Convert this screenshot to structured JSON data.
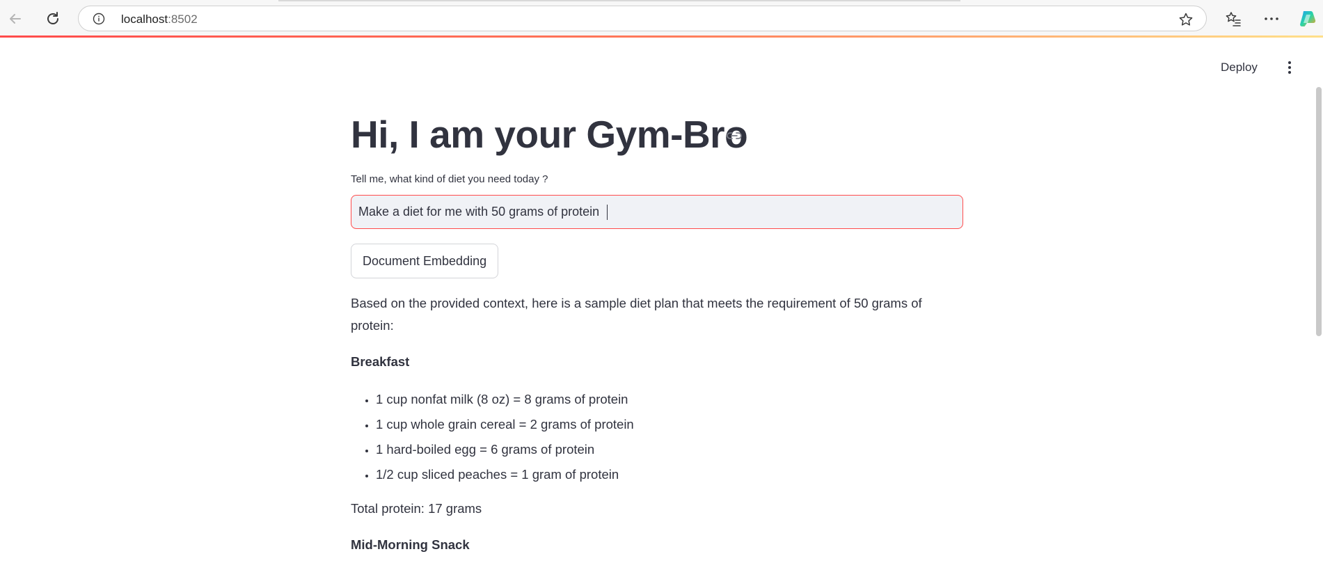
{
  "browser": {
    "url_host": "localhost",
    "url_port": ":8502"
  },
  "app_header": {
    "deploy_label": "Deploy"
  },
  "main": {
    "title": "Hi, I am your Gym-Bro",
    "input_label": "Tell me, what kind of diet you need today ?",
    "input_value": "Make a diet for me with 50 grams of protein",
    "embed_button_label": "Document Embedding",
    "answer": {
      "intro": "Based on the provided context, here is a sample diet plan that meets the requirement of 50 grams of protein:",
      "breakfast_heading": "Breakfast",
      "breakfast_items": [
        "1 cup nonfat milk (8 oz) = 8 grams of protein",
        "1 cup whole grain cereal = 2 grams of protein",
        "1 hard-boiled egg = 6 grams of protein",
        "1/2 cup sliced peaches = 1 gram of protein"
      ],
      "total": "Total protein: 17 grams",
      "snack_heading": "Mid-Morning Snack"
    }
  },
  "colors": {
    "accent": "#ff4b4b",
    "text": "#31333f",
    "input_bg": "#f0f2f6"
  },
  "icons": [
    "back-arrow-icon",
    "reload-icon",
    "info-icon",
    "star-icon",
    "favorites-icon",
    "more-icon",
    "copilot-icon",
    "link-icon",
    "kebab-menu-icon"
  ]
}
